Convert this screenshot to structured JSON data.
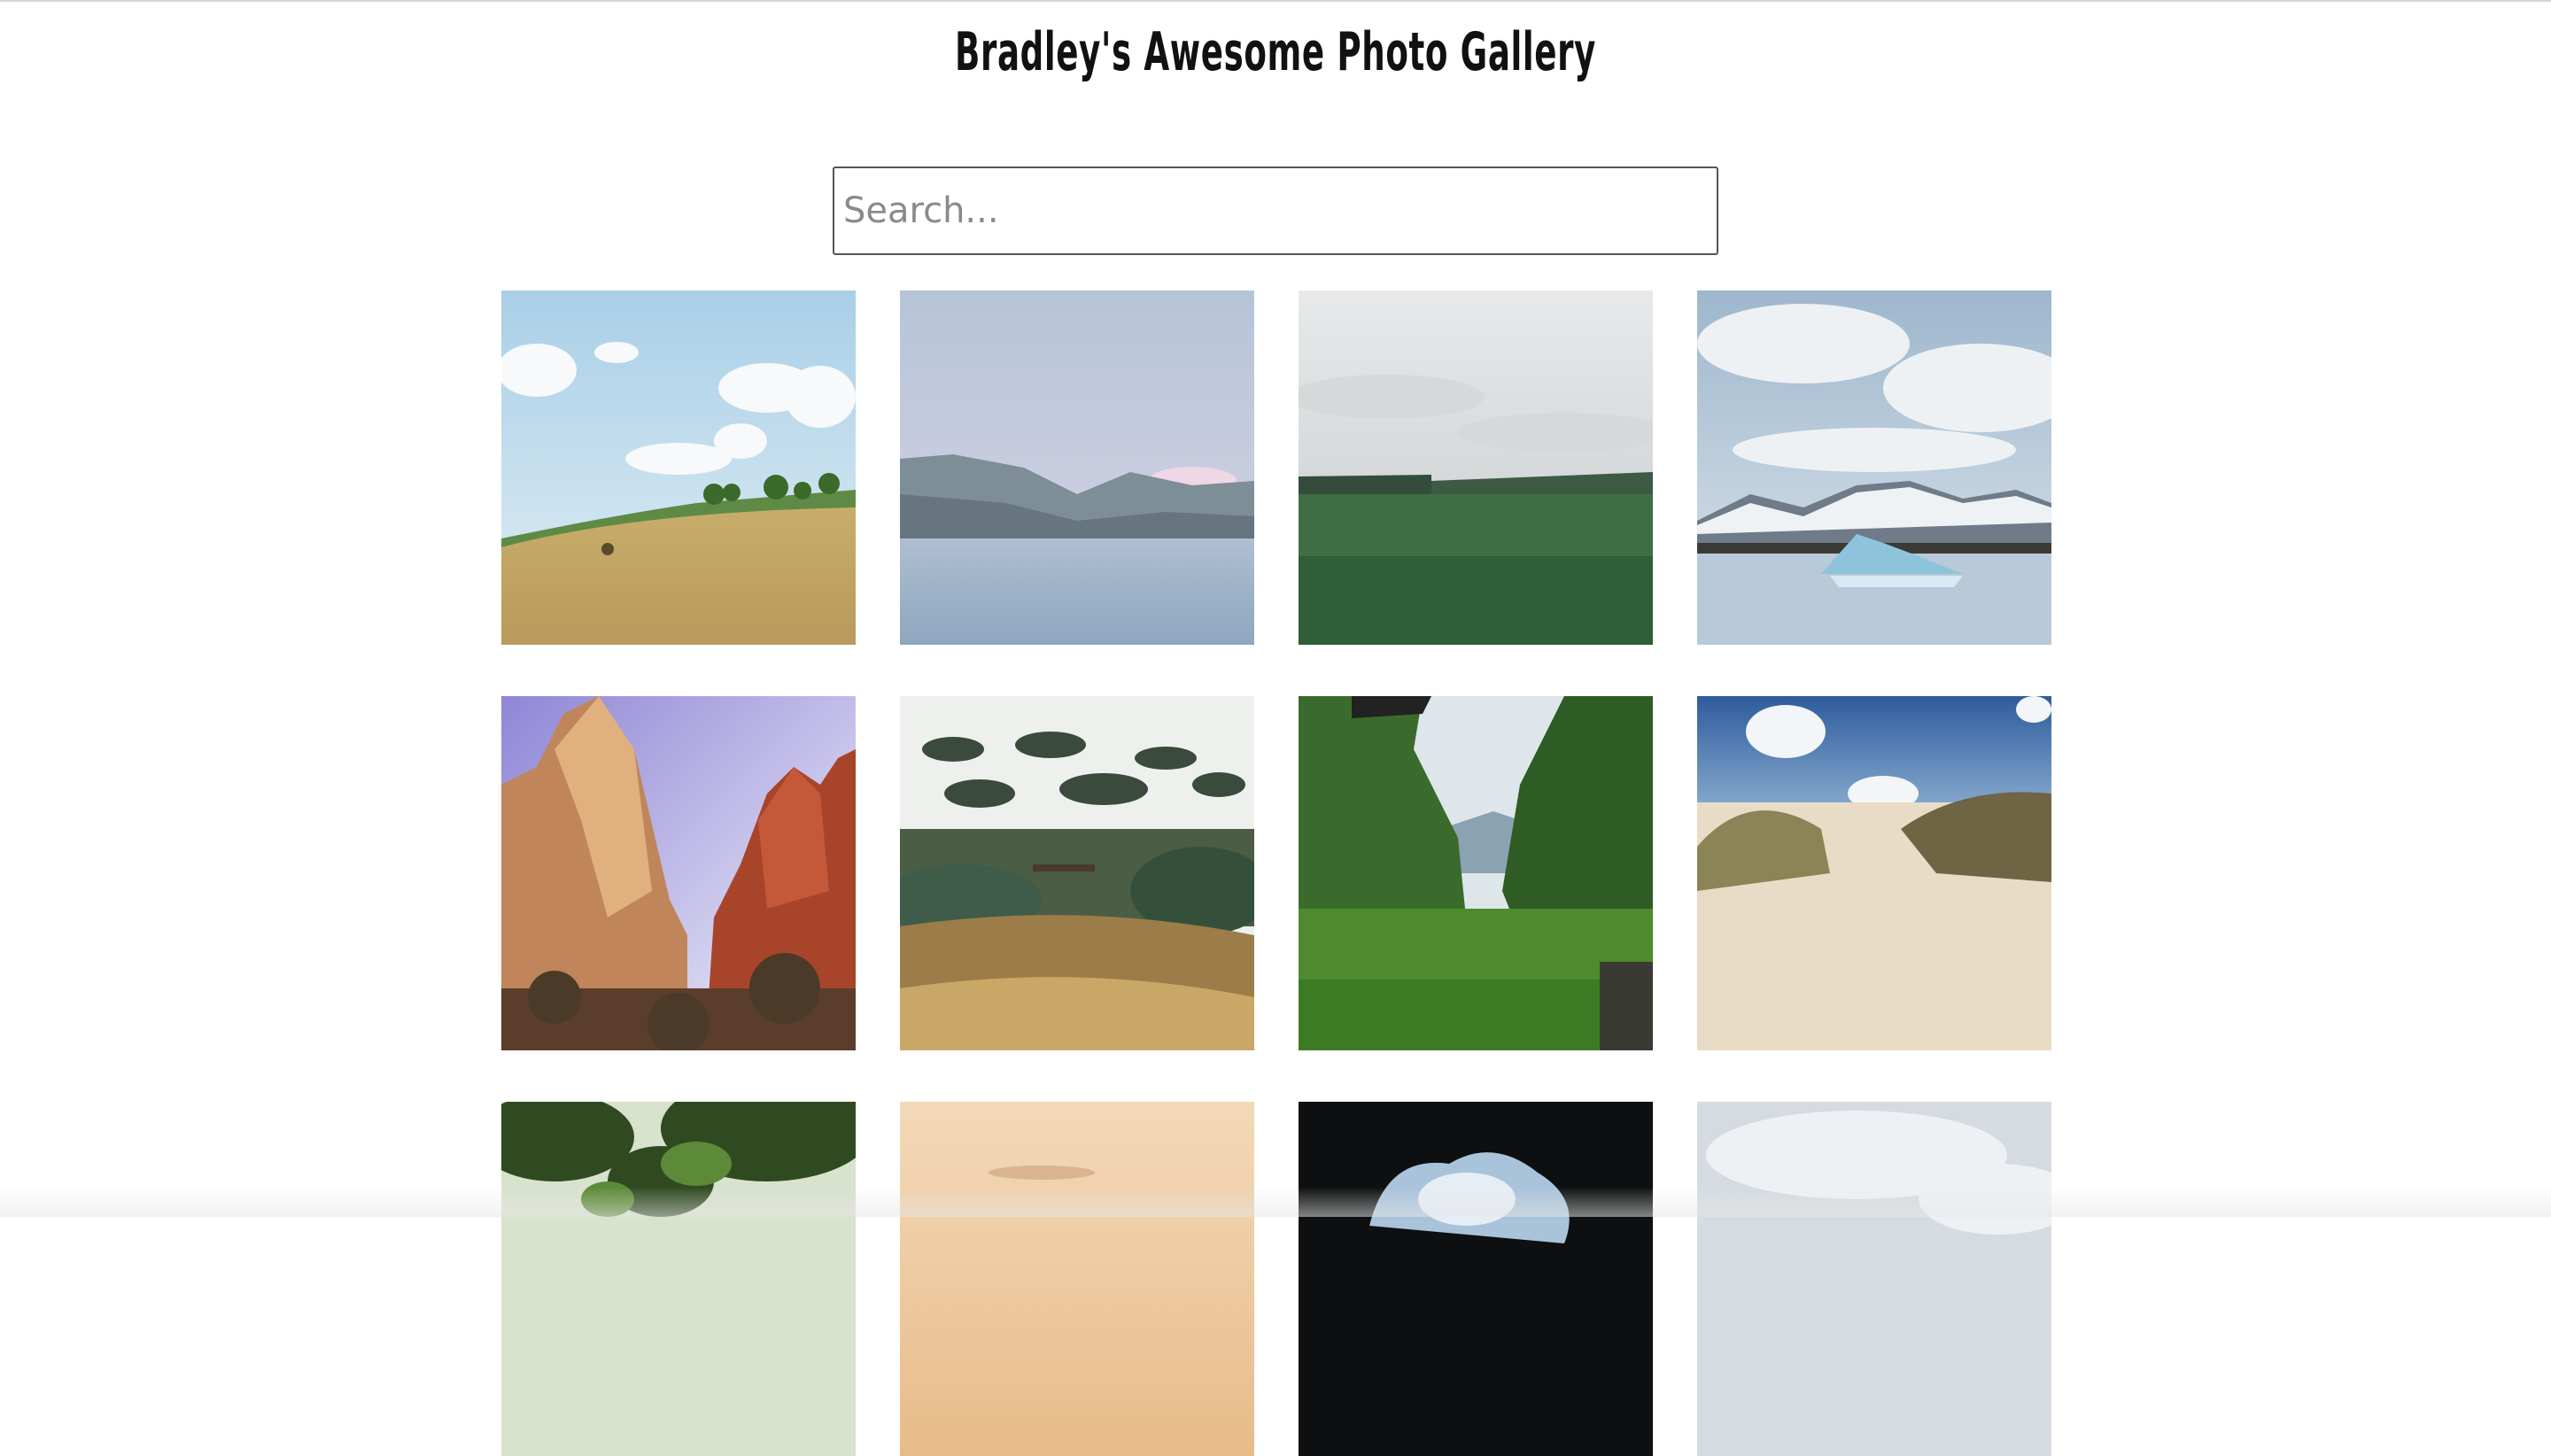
{
  "header": {
    "title": "Bradley's Awesome Photo Gallery"
  },
  "search": {
    "placeholder": "Search..."
  },
  "gallery": {
    "photos": [
      {
        "name": "photo-hay-field"
      },
      {
        "name": "photo-mountain-lake"
      },
      {
        "name": "photo-green-plain"
      },
      {
        "name": "photo-glacier-lagoon"
      },
      {
        "name": "photo-red-canyon"
      },
      {
        "name": "photo-garden-trees"
      },
      {
        "name": "photo-jungle-valley"
      },
      {
        "name": "photo-sand-dunes"
      },
      {
        "name": "photo-forest-canopy"
      },
      {
        "name": "photo-hazy-sunset"
      },
      {
        "name": "photo-cave-opening"
      },
      {
        "name": "photo-cloudy-sky"
      }
    ]
  }
}
